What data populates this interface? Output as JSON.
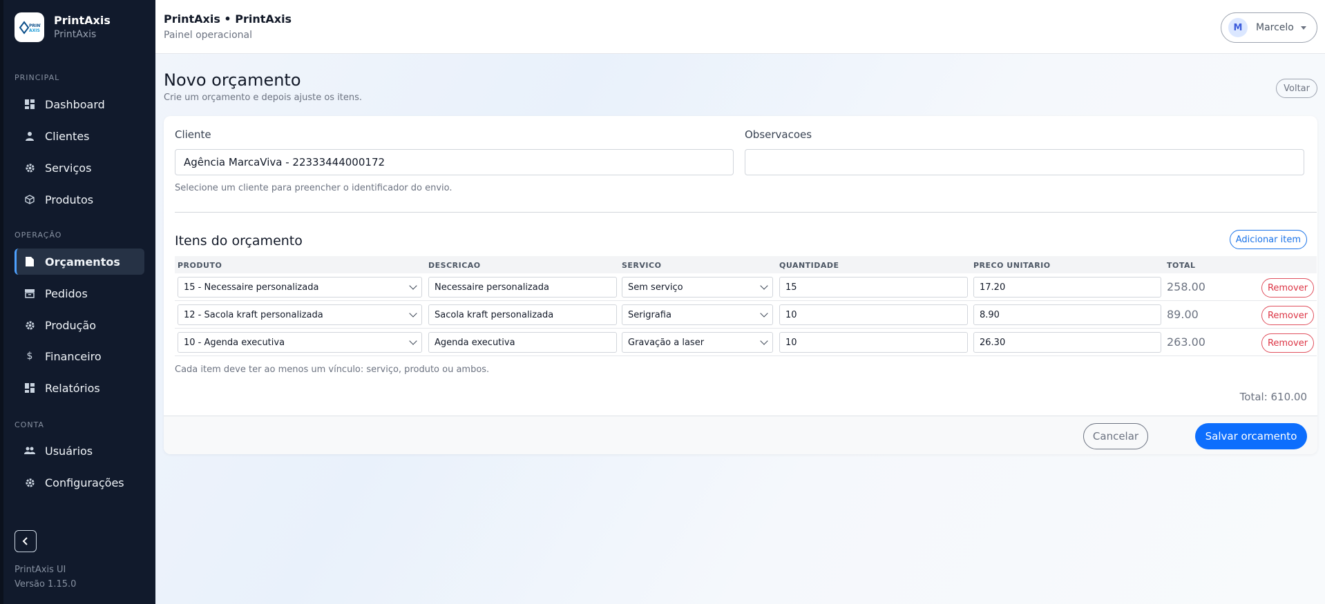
{
  "brand": {
    "title": "PrintAxis",
    "subtitle": "PrintAxis",
    "logo_text": "PRINT AXIS"
  },
  "sidebar": {
    "sections": {
      "principal": "PRINCIPAL",
      "operacao": "OPERAÇÃO",
      "conta": "CONTA"
    },
    "items": [
      {
        "label": "Dashboard",
        "icon": "dashboard-icon"
      },
      {
        "label": "Clientes",
        "icon": "user-icon"
      },
      {
        "label": "Serviços",
        "icon": "gear-icon"
      },
      {
        "label": "Produtos",
        "icon": "box-icon"
      },
      {
        "label": "Orçamentos",
        "icon": "document-icon",
        "active": true
      },
      {
        "label": "Pedidos",
        "icon": "archive-icon"
      },
      {
        "label": "Produção",
        "icon": "gear-icon"
      },
      {
        "label": "Financeiro",
        "icon": "dollar-icon"
      },
      {
        "label": "Relatórios",
        "icon": "dashboard-icon"
      },
      {
        "label": "Usuários",
        "icon": "users-icon"
      },
      {
        "label": "Configurações",
        "icon": "gear-icon"
      }
    ],
    "footer_name": "PrintAxis UI",
    "footer_version": "Versão 1.15.0"
  },
  "header": {
    "title": "PrintAxis • PrintAxis",
    "subtitle": "Painel operacional",
    "user_initial": "M",
    "user_name": "Marcelo"
  },
  "page": {
    "title": "Novo orçamento",
    "subtitle": "Crie um orçamento e depois ajuste os itens.",
    "back_label": "Voltar"
  },
  "form": {
    "cliente_label": "Cliente",
    "cliente_value": "Agência MarcaViva - 22333444000172",
    "cliente_hint": "Selecione um cliente para preencher o identificador do envio.",
    "obs_label": "Observacoes",
    "obs_value": ""
  },
  "items": {
    "title": "Itens do orçamento",
    "add_label": "Adicionar item",
    "columns": [
      "PRODUTO",
      "DESCRICAO",
      "SERVICO",
      "QUANTIDADE",
      "PRECO UNITARIO",
      "TOTAL"
    ],
    "rows": [
      {
        "produto": "15 - Necessaire personalizada",
        "descricao": "Necessaire personalizada",
        "servico": "Sem serviço",
        "quantidade": "15",
        "preco": "17.20",
        "total": "258.00"
      },
      {
        "produto": "12 - Sacola kraft personalizada",
        "descricao": "Sacola kraft personalizada",
        "servico": "Serigrafia",
        "quantidade": "10",
        "preco": "8.90",
        "total": "89.00"
      },
      {
        "produto": "10 - Agenda executiva",
        "descricao": "Agenda executiva",
        "servico": "Gravação a laser",
        "quantidade": "10",
        "preco": "26.30",
        "total": "263.00"
      }
    ],
    "remove_label": "Remover",
    "note": "Cada item deve ter ao menos um vínculo: serviço, produto ou ambos.",
    "grand_total": "Total: 610.00"
  },
  "actions": {
    "cancel_label": "Cancelar",
    "save_label": "Salvar orcamento"
  },
  "colors": {
    "sidebar_bg": "#111a2c",
    "accent": "#0d6efd",
    "danger": "#dc3545"
  }
}
